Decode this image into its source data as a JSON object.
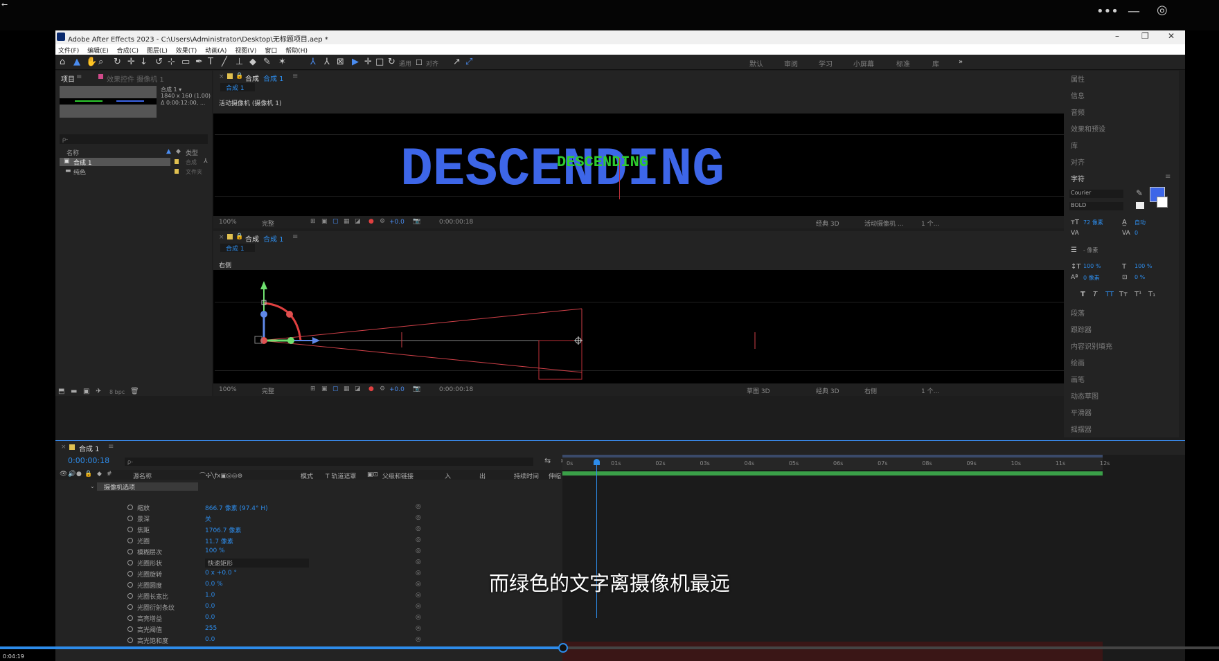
{
  "window": {
    "title": "Adobe After Effects 2023 - C:\\Users\\Administrator\\Desktop\\无标题项目.aep *",
    "minimize": "–",
    "maximize": "❐",
    "close": "✕"
  },
  "menu": [
    "文件(F)",
    "编辑(E)",
    "合成(C)",
    "图层(L)",
    "效果(T)",
    "动画(A)",
    "视图(V)",
    "窗口",
    "帮助(H)"
  ],
  "toolbar": {
    "snap_label": "对齐",
    "workspaces": [
      "默认",
      "审阅",
      "学习",
      "小屏幕",
      "标准",
      "库"
    ],
    "more": "»"
  },
  "project_panel": {
    "tab_label": "项目",
    "effects_tab": "效果控件 摄像机 1",
    "comp_name": "合成 1 ▾",
    "comp_size": "1840 x 160 (1.00)",
    "comp_duration": "Δ 0:00:12:00, ...",
    "search_placeholder": "ρ-",
    "col_name": "名称",
    "col_type": "类型",
    "items": [
      {
        "name": "合成 1",
        "type": "合成"
      },
      {
        "name": "纯色",
        "type": "文件夹"
      }
    ],
    "bpc": "8 bpc"
  },
  "viewer_top": {
    "tab_prefix": "合成",
    "tab_comp": "合成 1",
    "subtab": "合成 1",
    "camera_label": "活动摄像机 (摄像机 1)",
    "main_text": "DESCENDING",
    "small_text": "DESCENDING",
    "zoom": "100%",
    "quality": "完整",
    "exposure": "+0.0",
    "timecode": "0:00:00:18",
    "renderer": "经典 3D",
    "view": "活动摄像机 ...",
    "views_count": "1 个..."
  },
  "viewer_bottom": {
    "tab_prefix": "合成",
    "tab_comp": "合成 1",
    "subtab": "合成 1",
    "camera_label": "右侧",
    "zoom": "100%",
    "quality": "完整",
    "exposure": "+0.0",
    "timecode": "0:00:00:18",
    "draft": "草图 3D",
    "renderer": "经典 3D",
    "view": "右侧",
    "views_count": "1 个..."
  },
  "right_panel": {
    "items": [
      "属性",
      "信息",
      "音频",
      "效果和预设",
      "库",
      "对齐"
    ],
    "character_title": "字符",
    "font": "Courier",
    "style": "BOLD",
    "size": "72 像素",
    "leading": "自动",
    "tracking": "0",
    "stroke": "- 像素",
    "vscale": "100 %",
    "hscale": "100 %",
    "baseline": "0 像素",
    "tsume": "0 %",
    "text_color": "#3d66e8",
    "styles": [
      "T",
      "T",
      "TT",
      "Tт",
      "T¹",
      "T₁"
    ],
    "lower_items": [
      "段落",
      "跟踪器",
      "内容识别填充",
      "绘画",
      "画笔",
      "动态草图",
      "平滑器",
      "摇摆器"
    ]
  },
  "timeline": {
    "tab": "合成 1",
    "timecode": "0:00:00:18",
    "search_placeholder": "ρ-",
    "columns": {
      "source": "源名称",
      "mode": "模式",
      "trkmat": "T  轨道遮罩",
      "parent": "父级和链接",
      "in": "入",
      "out": "出",
      "duration": "持续时间",
      "stretch": "伸缩"
    },
    "group": "摄像机选项",
    "properties": [
      {
        "name": "缩放",
        "value": "866.7 像素 (97.4° H)"
      },
      {
        "name": "景深",
        "value": "关"
      },
      {
        "name": "焦距",
        "value": "1706.7 像素"
      },
      {
        "name": "光圈",
        "value": "11.7 像素"
      },
      {
        "name": "模糊层次",
        "value": "100 %"
      },
      {
        "name": "光圈形状",
        "value": "快速矩形"
      },
      {
        "name": "光圈旋转",
        "value": "0 x +0.0 °"
      },
      {
        "name": "光圈圆度",
        "value": "0.0 %"
      },
      {
        "name": "光圈长宽比",
        "value": "1.0"
      },
      {
        "name": "光圈衍射条纹",
        "value": "0.0"
      },
      {
        "name": "高亮增益",
        "value": "0.0"
      },
      {
        "name": "高光阈值",
        "value": "255"
      },
      {
        "name": "高光饱和度",
        "value": "0.0"
      }
    ],
    "ruler": [
      "0s",
      "01s",
      "02s",
      "03s",
      "04s",
      "05s",
      "06s",
      "07s",
      "08s",
      "09s",
      "10s",
      "11s",
      "12s"
    ],
    "playhead_fraction": 0.063
  },
  "player": {
    "elapsed": "0:04:19",
    "progress_fraction": 0.462
  },
  "subtitle": "而绿色的文字离摄像机最远"
}
